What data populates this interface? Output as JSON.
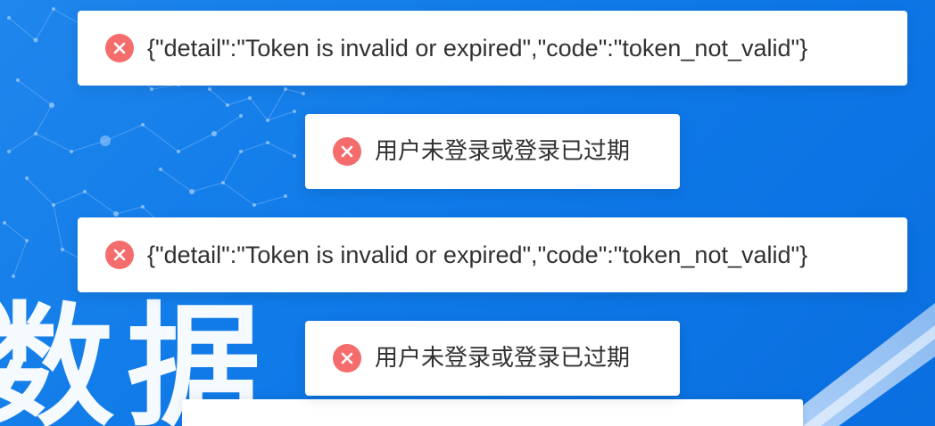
{
  "background": {
    "big_text": "数据",
    "gradient_start": "#1f86ec",
    "gradient_end": "#0a6fe0"
  },
  "toasts": [
    {
      "type": "error",
      "icon": "close-circle-icon",
      "text": "{\"detail\":\"Token is invalid or expired\",\"code\":\"token_not_valid\"}"
    },
    {
      "type": "error",
      "icon": "close-circle-icon",
      "text": "用户未登录或登录已过期"
    },
    {
      "type": "error",
      "icon": "close-circle-icon",
      "text": "{\"detail\":\"Token is invalid or expired\",\"code\":\"token_not_valid\"}"
    },
    {
      "type": "error",
      "icon": "close-circle-icon",
      "text": "用户未登录或登录已过期"
    }
  ],
  "colors": {
    "error_icon": "#f56c6c",
    "toast_text": "#303133",
    "toast_bg": "#ffffff"
  }
}
